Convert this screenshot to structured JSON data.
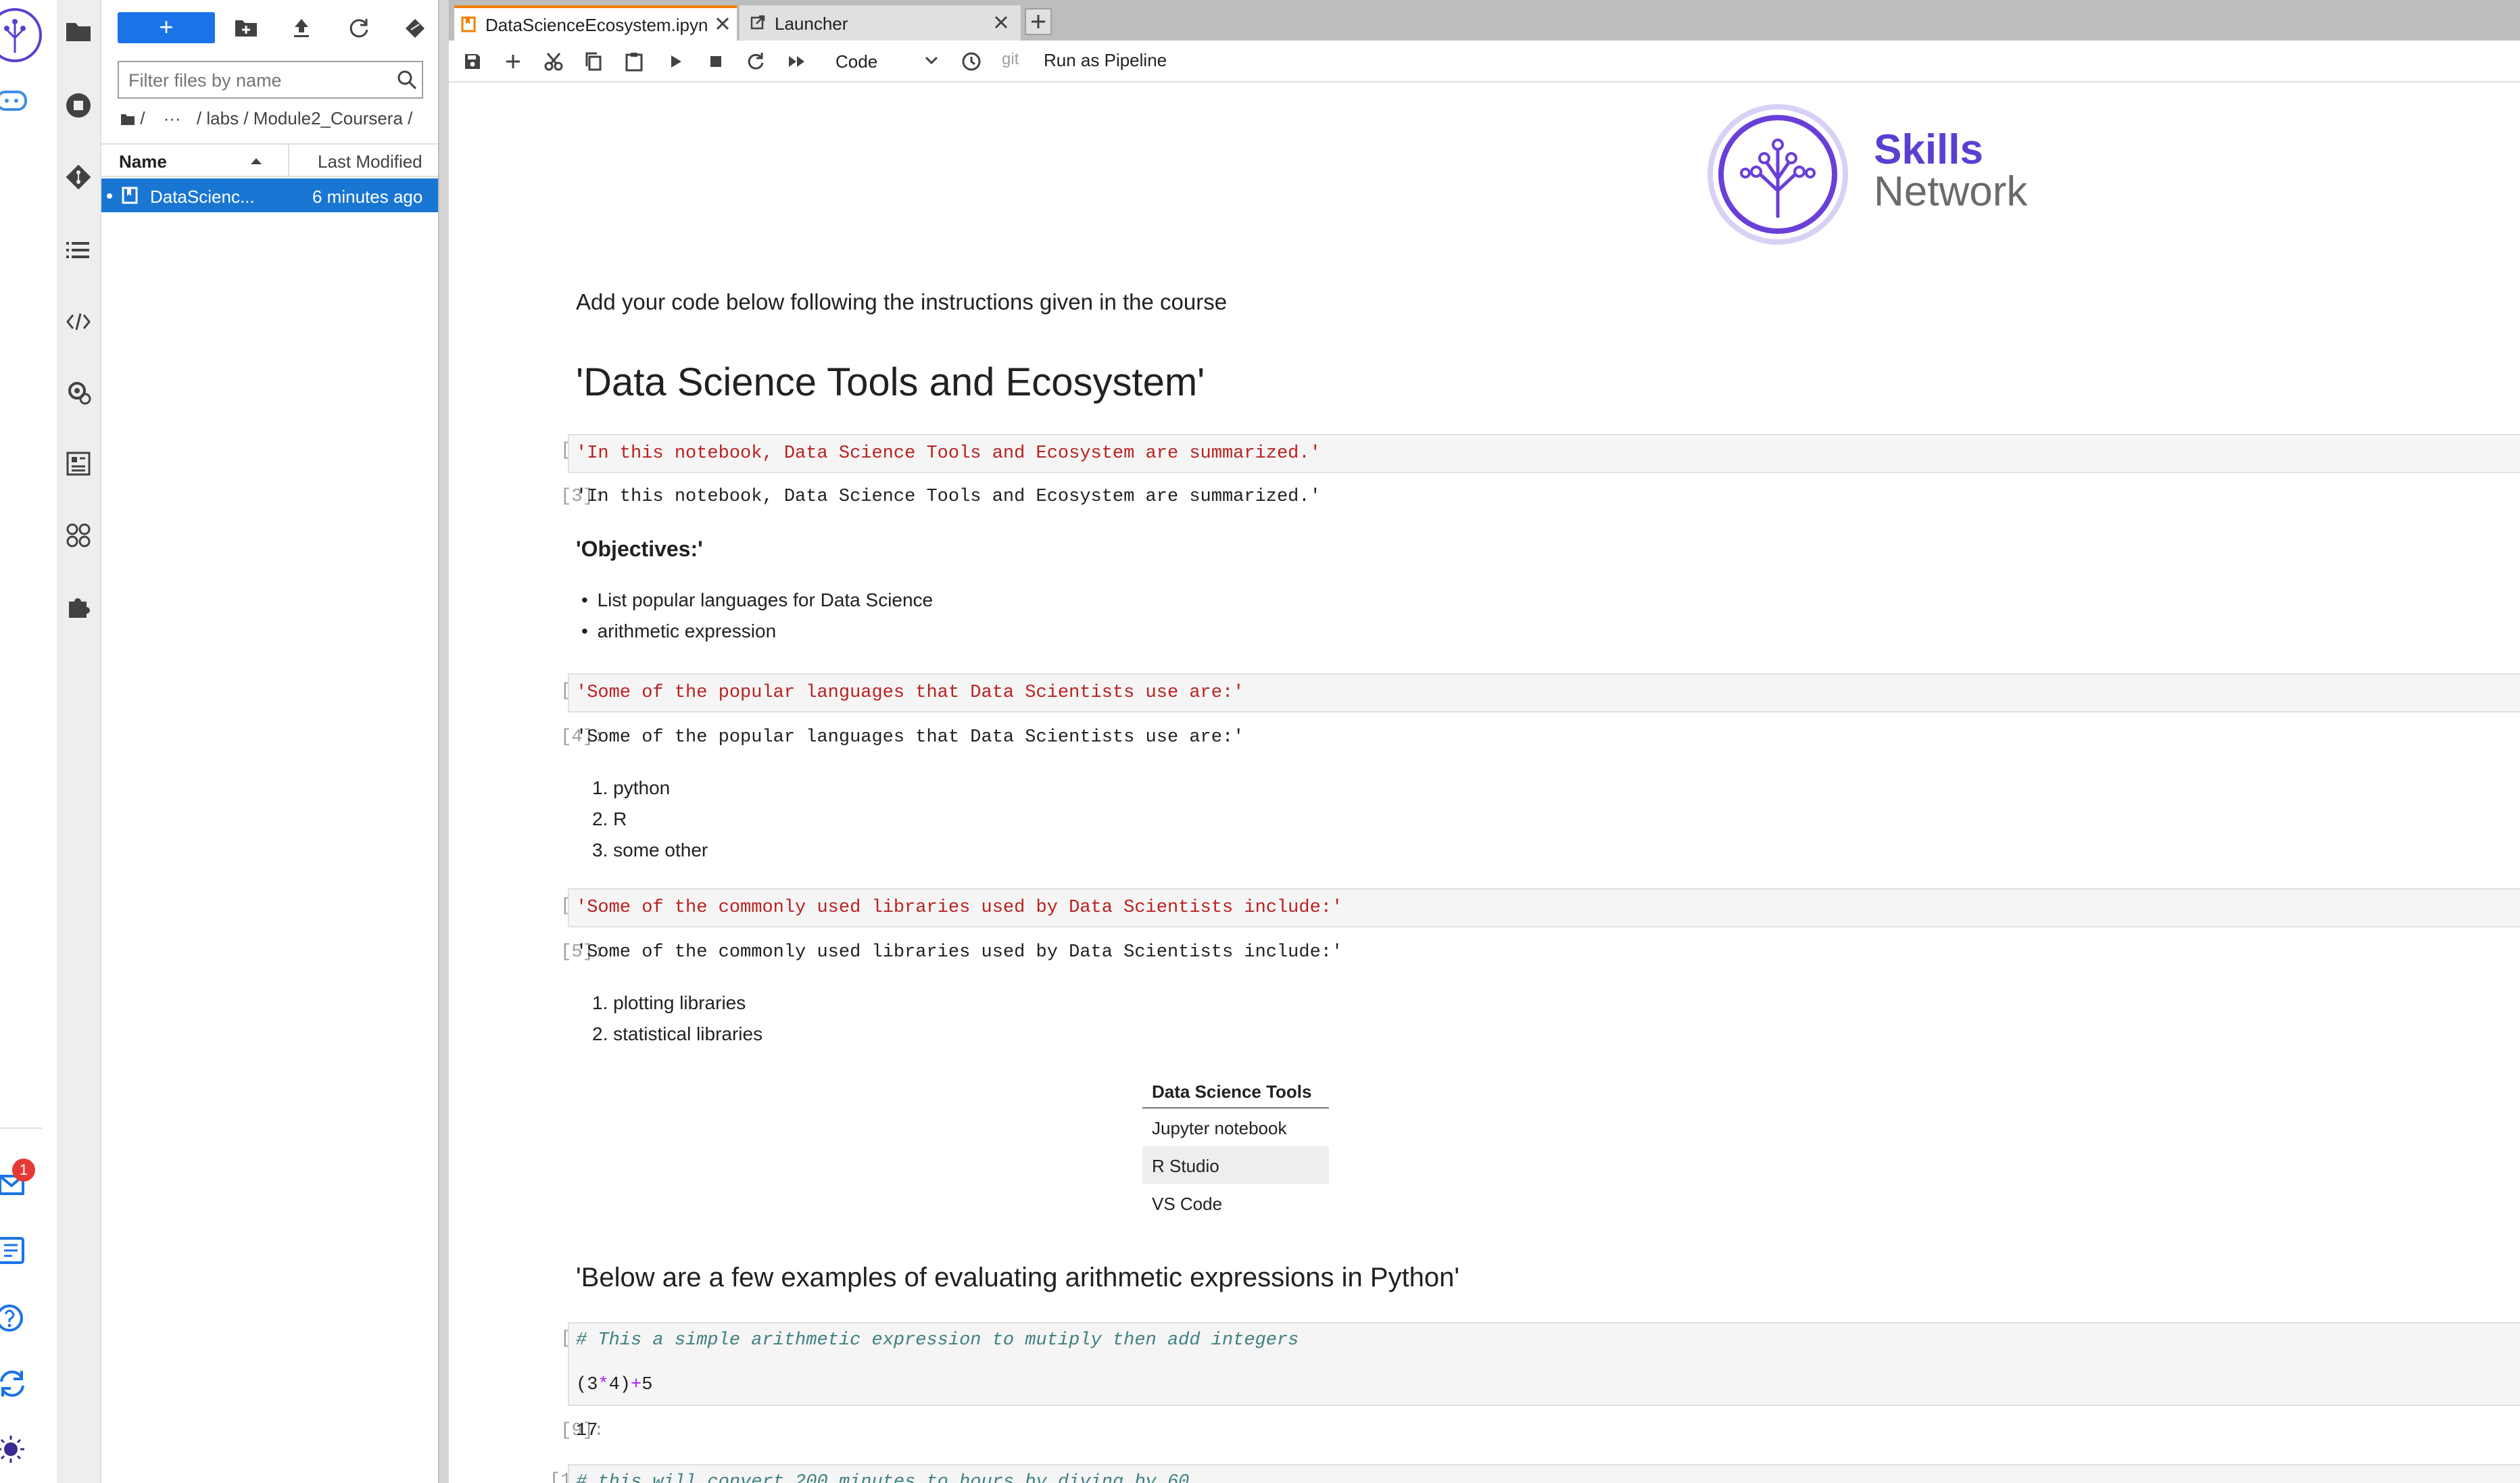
{
  "colors": {
    "accent": "#1a73e8",
    "selected_row": "#1976d2",
    "skills_purple": "#5b3fd1",
    "skills_gray": "#6b6b6b",
    "code_string": "#ba2121",
    "code_comment": "#408080",
    "badge_red": "#e53935"
  },
  "file_browser": {
    "new_button_label": "+",
    "filter_placeholder": "Filter files by name",
    "breadcrumb": {
      "root": "/",
      "ellipsis": "···",
      "sep1": "/",
      "labs": "labs",
      "sep2": "/",
      "module": "Module2_Coursera",
      "sep3": "/"
    },
    "columns": {
      "name": "Name",
      "last_modified": "Last Modified"
    },
    "files": [
      {
        "name": "DataScienc...",
        "modified": "6 minutes ago",
        "selected": true
      }
    ]
  },
  "rail": {
    "notification_count": "1"
  },
  "tabs": [
    {
      "label": "DataScienceEcosystem.ipyn",
      "active": true,
      "icon": "notebook-icon"
    },
    {
      "label": "Launcher",
      "active": false,
      "icon": "launcher-icon"
    }
  ],
  "toolbar": {
    "cell_type": "Code",
    "git_label": "git",
    "pipeline_label": "Run as Pipeline"
  },
  "logo": {
    "line1": "Skills",
    "line2": "Network"
  },
  "notebook": {
    "intro_text": "Add your code below following the instructions given in the course",
    "title": "'Data Science Tools and Ecosystem'",
    "cell3": {
      "in_prompt": "[3]:",
      "code": "'In this notebook, Data Science Tools and Ecosystem are summarized.'",
      "out_prompt": "[3]:",
      "output": "'In this notebook, Data Science Tools and Ecosystem are summarized.'"
    },
    "objectives_heading": "'Objectives:'",
    "objectives": [
      "List popular languages for Data Science",
      "arithmetic expression"
    ],
    "cell4": {
      "in_prompt": "[4]:",
      "code": "'Some of the popular languages that Data Scientists use are:'",
      "out_prompt": "[4]:",
      "output": "'Some of the popular languages that Data Scientists use are:'"
    },
    "languages": [
      {
        "n": "1.",
        "t": "python"
      },
      {
        "n": "2.",
        "t": "R"
      },
      {
        "n": "3.",
        "t": "some other"
      }
    ],
    "cell5": {
      "in_prompt": "[5]:",
      "code": "'Some of the commonly used libraries used by Data Scientists include:'",
      "out_prompt": "[5]:",
      "output": "'Some of the commonly used libraries used by Data Scientists include:'"
    },
    "libraries": [
      {
        "n": "1.",
        "t": "plotting libraries"
      },
      {
        "n": "2.",
        "t": "statistical libraries"
      }
    ],
    "tools_table": {
      "header": "Data Science Tools",
      "rows": [
        "Jupyter notebook",
        "R Studio",
        "VS Code"
      ]
    },
    "arith_heading": "'Below are a few examples of evaluating arithmetic expressions in Python'",
    "cell9": {
      "in_prompt": "[9]:",
      "comment": "# This a simple arithmetic expression to mutiply then add integers",
      "expr_open": "(3",
      "expr_op1": "*",
      "expr_mid": "4)",
      "expr_op2": "+",
      "expr_end": "5",
      "out_prompt": "[9]:",
      "output": "17"
    },
    "cell10": {
      "in_prompt": "[10]:",
      "comment": "# this will convert 200 minutes to hours by diving by 60"
    }
  }
}
